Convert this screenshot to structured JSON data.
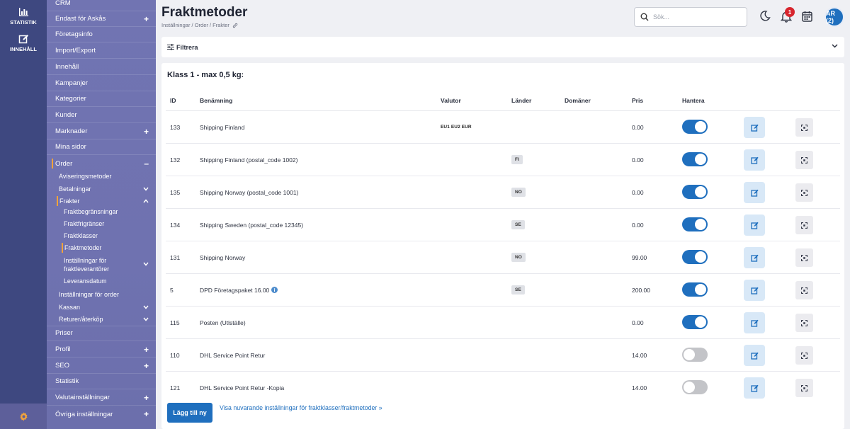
{
  "rail": {
    "items": [
      {
        "label": "STATISTIK",
        "icon": "bar-chart-icon"
      },
      {
        "label": "INNEHÅLL",
        "icon": "edit-icon"
      }
    ],
    "settings_icon": "gear-icon",
    "settings_color": "#f2a33a"
  },
  "sidebar": {
    "items": [
      {
        "label": "CRM"
      },
      {
        "label": "Endast för Askås",
        "expand": "+"
      },
      {
        "label": "Företagsinfo"
      },
      {
        "label": "Import/Export"
      },
      {
        "label": "Innehåll"
      },
      {
        "label": "Kampanjer"
      },
      {
        "label": "Kategorier"
      },
      {
        "label": "Kunder"
      },
      {
        "label": "Marknader",
        "expand": "+"
      },
      {
        "label": "Mina sidor"
      },
      {
        "label": "Order",
        "expand": "–"
      },
      {
        "label": "Priser"
      },
      {
        "label": "Profil",
        "expand": "+"
      },
      {
        "label": "SEO",
        "expand": "+"
      },
      {
        "label": "Statistik"
      },
      {
        "label": "Valutainställningar",
        "expand": "+"
      },
      {
        "label": "Övriga inställningar",
        "expand": "+"
      }
    ],
    "order_sub": [
      {
        "label": "Aviseringsmetoder"
      },
      {
        "label": "Betalningar"
      },
      {
        "label": "Frakter"
      },
      {
        "label": "Inställningar för order"
      },
      {
        "label": "Kassan"
      },
      {
        "label": "Returer/återköp"
      }
    ],
    "frakter_sub": [
      {
        "label": "Fraktbegränsningar"
      },
      {
        "label": "Fraktfrigränser"
      },
      {
        "label": "Fraktklasser"
      },
      {
        "label": "Fraktmetoder"
      },
      {
        "label": "Inställningar för fraktleverantörer",
        "line1": "Inställningar för",
        "line2": "fraktleverantörer"
      },
      {
        "label": "Leveransdatum"
      }
    ]
  },
  "header": {
    "title": "Fraktmetoder",
    "breadcrumb": "Inställningar / Order / Frakter",
    "search_placeholder": "Sök...",
    "notification_count": "1",
    "avatar_label": "AR (2)"
  },
  "filter": {
    "label": "Filtrera"
  },
  "section": {
    "title": "Klass 1 - max 0,5 kg:"
  },
  "table": {
    "columns": [
      "ID",
      "Benämning",
      "Valutor",
      "Länder",
      "Domäner",
      "Pris",
      "Hantera"
    ],
    "rows": [
      {
        "id": "133",
        "name": "Shipping Finland",
        "currencies": "EU1 EU2 EUR",
        "country": "",
        "domains": "",
        "price": "0.00",
        "active": true,
        "info": false
      },
      {
        "id": "132",
        "name": "Shipping Finland (postal_code 1002)",
        "currencies": "",
        "country": "FI",
        "domains": "",
        "price": "0.00",
        "active": true,
        "info": false
      },
      {
        "id": "135",
        "name": "Shipping Norway (postal_code 1001)",
        "currencies": "",
        "country": "NO",
        "domains": "",
        "price": "0.00",
        "active": true,
        "info": false
      },
      {
        "id": "134",
        "name": "Shipping Sweden (postal_code 12345)",
        "currencies": "",
        "country": "SE",
        "domains": "",
        "price": "0.00",
        "active": true,
        "info": false
      },
      {
        "id": "131",
        "name": "Shipping Norway",
        "currencies": "",
        "country": "NO",
        "domains": "",
        "price": "99.00",
        "active": true,
        "info": false
      },
      {
        "id": "5",
        "name": "DPD Företagspaket 16.00",
        "currencies": "",
        "country": "SE",
        "domains": "",
        "price": "200.00",
        "active": true,
        "info": true
      },
      {
        "id": "115",
        "name": "Posten (Utlställe)",
        "currencies": "",
        "country": "",
        "domains": "",
        "price": "0.00",
        "active": true,
        "info": false
      },
      {
        "id": "110",
        "name": "DHL Service Point Retur",
        "currencies": "",
        "country": "",
        "domains": "",
        "price": "14.00",
        "active": false,
        "info": false
      },
      {
        "id": "121",
        "name": "DHL Service Point Retur -Kopia",
        "currencies": "",
        "country": "",
        "domains": "",
        "price": "14.00",
        "active": false,
        "info": false
      }
    ]
  },
  "actions": {
    "add_label": "Lägg till ny",
    "show_settings_link": "Visa nuvarande inställningar för fraktklasser/fraktmetoder »"
  },
  "colors": {
    "accent": "#1f6fbe",
    "sidebar_bg": "#7072b0",
    "rail_bg": "#3e4880",
    "active_marker": "#f2a33a",
    "badge": "#d7262e"
  }
}
